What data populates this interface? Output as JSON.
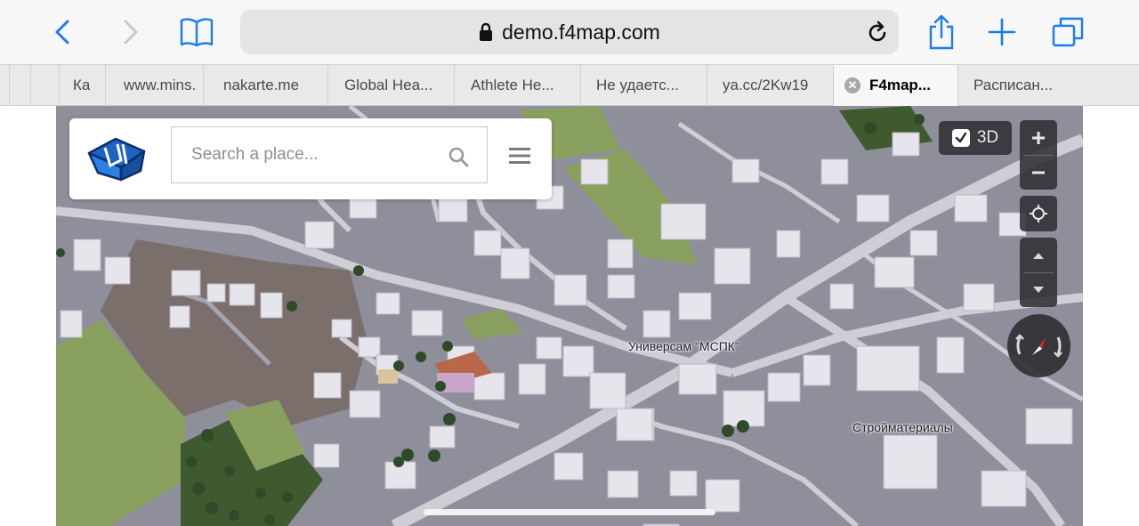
{
  "browser": {
    "url": "demo.f4map.com",
    "tabs": [
      {
        "title": "Ка"
      },
      {
        "title": "www.mins."
      },
      {
        "title": "nakarte.me"
      },
      {
        "title": "Global Hea..."
      },
      {
        "title": "Athlete He..."
      },
      {
        "title": "Не удаетс..."
      },
      {
        "title": "ya.cc/2Kw19"
      },
      {
        "title": "F4map...",
        "active": true
      },
      {
        "title": "Расписан..."
      }
    ],
    "icons": [
      "back-icon",
      "forward-icon",
      "bookmarks-icon",
      "lock-icon",
      "reload-icon",
      "share-icon",
      "new-tab-icon",
      "tabs-overview-icon"
    ]
  },
  "map": {
    "search_placeholder": "Search a place...",
    "toggle_3d_label": "3D",
    "toggle_3d_checked": true,
    "labels": {
      "universam": "Универсам \"МСПК\"",
      "stroymaterialy": "Стройматериалы"
    },
    "colors": {
      "ground": "#8f8e9b",
      "road": "#cfcdd6",
      "building": "#e8e7ee",
      "grass": "#8da561",
      "dirt": "#7d716e",
      "accent": "#1e88e5"
    }
  }
}
